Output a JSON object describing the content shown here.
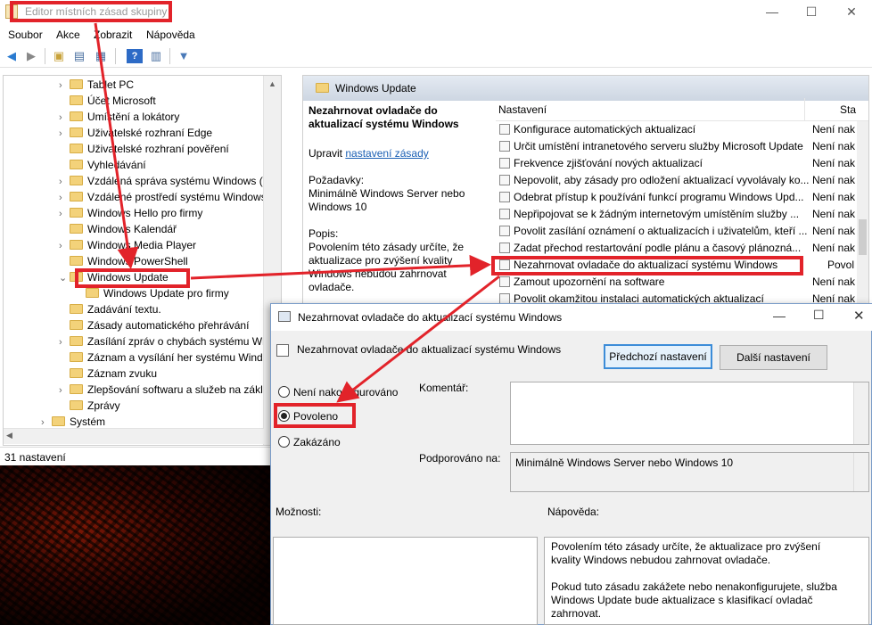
{
  "window": {
    "title": "Editor místních zásad skupiny"
  },
  "menu": [
    "Soubor",
    "Akce",
    "Zobrazit",
    "Nápověda"
  ],
  "tree": {
    "items": [
      {
        "label": "Tablet PC",
        "chevron": "›"
      },
      {
        "label": "Účet Microsoft",
        "chevron": ""
      },
      {
        "label": "Umístění a lokátory",
        "chevron": "›"
      },
      {
        "label": "Uživatelské rozhraní Edge",
        "chevron": "›"
      },
      {
        "label": "Uživatelské rozhraní pověření",
        "chevron": ""
      },
      {
        "label": "Vyhledávání",
        "chevron": ""
      },
      {
        "label": "Vzdálená správa systému Windows (Win",
        "chevron": "›"
      },
      {
        "label": "Vzdálené prostředí systému Windows",
        "chevron": "›"
      },
      {
        "label": "Windows Hello pro firmy",
        "chevron": "›"
      },
      {
        "label": "Windows Kalendář",
        "chevron": ""
      },
      {
        "label": "Windows Media Player",
        "chevron": "›"
      },
      {
        "label": "Windows PowerShell",
        "chevron": ""
      },
      {
        "label": "Windows Update",
        "chevron": "⌄"
      },
      {
        "label": "Windows Update pro firmy",
        "chevron": ""
      },
      {
        "label": "Zadávání textu.",
        "chevron": ""
      },
      {
        "label": "Zásady automatického přehrávání",
        "chevron": ""
      },
      {
        "label": "Zasílání zpráv o chybách systému Wir",
        "chevron": "›"
      },
      {
        "label": "Záznam a vysílání her systému Windo",
        "chevron": ""
      },
      {
        "label": "Záznam zvuku",
        "chevron": ""
      },
      {
        "label": "Zlepšování softwaru a služeb na zákla",
        "chevron": "›"
      },
      {
        "label": "Zprávy",
        "chevron": ""
      },
      {
        "label": "Systém",
        "chevron": "›"
      }
    ]
  },
  "status": {
    "text": "31 nastavení"
  },
  "right_pane": {
    "header": "Windows Update",
    "desc_title": "Nezahrnovat ovladače do aktualizací systému Windows",
    "edit_prefix": "Upravit",
    "edit_link": "nastavení zásady",
    "req_label": "Požadavky:",
    "req_text": "Minimálně Windows Server nebo Windows 10",
    "desc_label": "Popis:",
    "desc_text": "Povolením této zásady určíte, že aktualizace pro zvýšení kvality Windows nebudou zahrnovat ovladače.",
    "col_setting": "Nastavení",
    "col_state": "Sta",
    "rows": [
      {
        "name": "Konfigurace automatických aktualizací",
        "state": "Není nak"
      },
      {
        "name": "Určit umístění intranetového serveru služby Microsoft Update",
        "state": "Není nak"
      },
      {
        "name": "Frekvence zjišťování nových aktualizací",
        "state": "Není nak"
      },
      {
        "name": "Nepovolit, aby zásady pro odložení aktualizací vyvolávaly ko...",
        "state": "Není nak"
      },
      {
        "name": "Odebrat přístup k používání funkcí programu Windows Upd...",
        "state": "Není nak"
      },
      {
        "name": "Nepřipojovat se k žádným internetovým umístěním služby ...",
        "state": "Není nak"
      },
      {
        "name": "Povolit zasílání oznámení o aktualizacích i uživatelům, kteří ...",
        "state": "Není nak"
      },
      {
        "name": "Zadat přechod restartování podle plánu a časový plánozná...",
        "state": "Není nak"
      },
      {
        "name": "Nezahrnovat ovladače do aktualizací systému Windows",
        "state": "Povol"
      },
      {
        "name": "Zamout upozornění na software",
        "state": "Není nak"
      },
      {
        "name": "Povolit okamžitou instalaci automatických aktualizací",
        "state": "Není nak"
      }
    ]
  },
  "dialog": {
    "title": "Nezahrnovat ovladače do aktualizací systému Windows",
    "subtitle": "Nezahrnovat ovladače do aktualizací systému Windows",
    "prev_btn": "Předchozí nastavení",
    "next_btn": "Další nastavení",
    "radio_not_configured": "Není nakonfigurováno",
    "radio_enabled": "Povoleno",
    "radio_disabled": "Zakázáno",
    "comment_label": "Komentář:",
    "supported_label": "Podporováno na:",
    "supported_value": "Minimálně Windows Server nebo Windows 10",
    "options_label": "Možnosti:",
    "help_label": "Nápověda:",
    "help_p1": "Povolením této zásady určíte, že aktualizace pro zvýšení kvality Windows nebudou zahrnovat ovladače.",
    "help_p2": "Pokud tuto zásadu zakážete nebo nenakonfigurujete, služba Windows Update bude aktualizace s klasifikací ovladač zahrnovat."
  },
  "colors": {
    "annotation": "#e2232a",
    "header_gradient": "#cdd6e2",
    "primary_border": "#3c8cd8"
  }
}
